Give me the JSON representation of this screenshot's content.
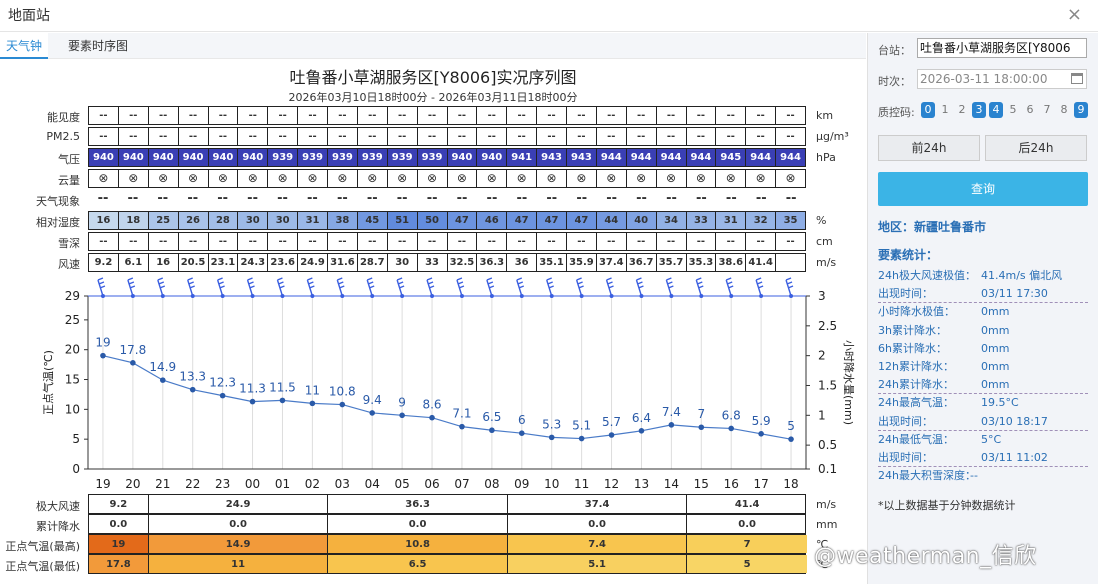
{
  "window": {
    "title": "地面站",
    "close": "×"
  },
  "tabs": [
    "天气钟",
    "要素时序图"
  ],
  "title": "吐鲁番小草湖服务区[Y8006]实况序列图",
  "subtitle": "2026年03月10日18时00分 - 2026年03月11日18时00分",
  "rows": [
    {
      "label": "能见度",
      "unit": "km",
      "values": [
        "--",
        "--",
        "--",
        "--",
        "--",
        "--",
        "--",
        "--",
        "--",
        "--",
        "--",
        "--",
        "--",
        "--",
        "--",
        "--",
        "--",
        "--",
        "--",
        "--",
        "--",
        "--",
        "--",
        "--",
        "--"
      ]
    },
    {
      "label": "PM2.5",
      "unit": "μg/m³",
      "values": [
        "--",
        "--",
        "--",
        "--",
        "--",
        "--",
        "--",
        "--",
        "--",
        "--",
        "--",
        "--",
        "--",
        "--",
        "--",
        "--",
        "--",
        "--",
        "--",
        "--",
        "--",
        "--",
        "--",
        "--",
        "--"
      ]
    },
    {
      "label": "气压",
      "unit": "hPa",
      "values": [
        "940",
        "940",
        "940",
        "940",
        "940",
        "940",
        "939",
        "939",
        "939",
        "939",
        "939",
        "939",
        "940",
        "940",
        "941",
        "943",
        "943",
        "944",
        "944",
        "944",
        "944",
        "945",
        "944",
        "944",
        "944"
      ]
    },
    {
      "label": "云量",
      "unit": "",
      "values": [
        "⊗",
        "⊗",
        "⊗",
        "⊗",
        "⊗",
        "⊗",
        "⊗",
        "⊗",
        "⊗",
        "⊗",
        "⊗",
        "⊗",
        "⊗",
        "⊗",
        "⊗",
        "⊗",
        "⊗",
        "⊗",
        "⊗",
        "⊗",
        "⊗",
        "⊗",
        "⊗",
        "⊗",
        "⊗"
      ]
    },
    {
      "label": "天气现象",
      "unit": "",
      "values": [
        "--",
        "--",
        "--",
        "--",
        "--",
        "--",
        "--",
        "--",
        "--",
        "--",
        "--",
        "--",
        "--",
        "--",
        "--",
        "--",
        "--",
        "--",
        "--",
        "--",
        "--",
        "--",
        "--",
        "--",
        "--"
      ]
    },
    {
      "label": "相对湿度",
      "unit": "%",
      "values": [
        "16",
        "18",
        "25",
        "26",
        "28",
        "30",
        "30",
        "31",
        "38",
        "45",
        "51",
        "50",
        "47",
        "46",
        "47",
        "47",
        "47",
        "44",
        "40",
        "34",
        "33",
        "31",
        "32",
        "35",
        "35"
      ]
    },
    {
      "label": "雪深",
      "unit": "cm",
      "values": [
        "--",
        "--",
        "--",
        "--",
        "--",
        "--",
        "--",
        "--",
        "--",
        "--",
        "--",
        "--",
        "--",
        "--",
        "--",
        "--",
        "--",
        "--",
        "--",
        "--",
        "--",
        "--",
        "--",
        "--",
        "--"
      ]
    },
    {
      "label": "风速",
      "unit": "m/s",
      "values": [
        "9.2",
        "6.1",
        "16",
        "20.5",
        "23.1",
        "24.3",
        "23.6",
        "24.9",
        "31.6",
        "28.7",
        "30",
        "33",
        "32.5",
        "36.3",
        "36",
        "35.1",
        "35.9",
        "37.4",
        "36.7",
        "35.7",
        "35.3",
        "38.6",
        "41.4",
        "",
        ""
      ]
    }
  ],
  "chart_data": {
    "type": "line",
    "x": [
      "19",
      "20",
      "21",
      "22",
      "23",
      "00",
      "01",
      "02",
      "03",
      "04",
      "05",
      "06",
      "07",
      "08",
      "09",
      "10",
      "11",
      "12",
      "13",
      "14",
      "15",
      "16",
      "17",
      "18"
    ],
    "series": [
      {
        "values": [
          19,
          17.8,
          14.9,
          13.3,
          12.3,
          11.3,
          11.5,
          11,
          10.8,
          9.4,
          9,
          8.6,
          7.1,
          6.5,
          6,
          5.3,
          5.1,
          5.7,
          6.4,
          7.4,
          7,
          6.8,
          5.9,
          5
        ]
      }
    ],
    "ylabel": "正点气温(℃)",
    "y2label": "小时降水量(mm)",
    "ylim": [
      0,
      29
    ],
    "y2lim": [
      0.1,
      3
    ],
    "yticks": [
      "0",
      "5",
      "10",
      "15",
      "20",
      "25",
      "29"
    ],
    "y2ticks": [
      "0.1",
      "0.5",
      "1",
      "1.5",
      "2",
      "2.5",
      "3"
    ]
  },
  "bottom": {
    "groups": [
      "",
      "",
      "",
      "",
      ""
    ],
    "rows": [
      {
        "label": "极大风速",
        "unit": "m/s",
        "values": [
          "9.2",
          "24.9",
          "36.3",
          "37.4",
          "41.4"
        ]
      },
      {
        "label": "累计降水",
        "unit": "mm",
        "values": [
          "0.0",
          "0.0",
          "0.0",
          "0.0",
          "0.0"
        ]
      },
      {
        "label": "正点气温(最高)",
        "unit": "℃",
        "values": [
          "19",
          "14.9",
          "10.8",
          "7.4",
          "7"
        ]
      },
      {
        "label": "正点气温(最低)",
        "unit": "℃",
        "values": [
          "17.8",
          "11",
          "6.5",
          "5.1",
          "5"
        ]
      }
    ]
  },
  "side": {
    "station_label": "台站：",
    "station_value": "吐鲁番小草湖服务区[Y8006",
    "time_label": "时次：",
    "time_value": "2026-03-11 18:00:00",
    "qc_label": "质控码:",
    "qc_codes": [
      "0",
      "1",
      "2",
      "3",
      "4",
      "5",
      "6",
      "7",
      "8",
      "9"
    ],
    "prev": "前24h",
    "next": "后24h",
    "query": "查询",
    "region": "地区：新疆吐鲁番市",
    "stats_title": "要素统计：",
    "stats": [
      {
        "k": "24h极大风速极值：",
        "v": "41.4m/s 偏北风"
      },
      {
        "k": "出现时间：",
        "v": "03/11 17:30"
      },
      {
        "k": "小时降水极值：",
        "v": "0mm"
      },
      {
        "k": "3h累计降水：",
        "v": "0mm"
      },
      {
        "k": "6h累计降水：",
        "v": "0mm"
      },
      {
        "k": "12h累计降水：",
        "v": "0mm"
      },
      {
        "k": "24h累计降水：",
        "v": "0mm"
      },
      {
        "k": "24h最高气温：",
        "v": "19.5°C"
      },
      {
        "k": "出现时间：",
        "v": "03/10 18:17"
      },
      {
        "k": "24h最低气温：",
        "v": "5°C"
      },
      {
        "k": "出现时间：",
        "v": "03/11 11:02"
      },
      {
        "k": "24h最大积雪深度：",
        "v": "--"
      }
    ],
    "note": "*以上数据基于分钟数据统计"
  },
  "watermark": "@weatherman_信欣"
}
